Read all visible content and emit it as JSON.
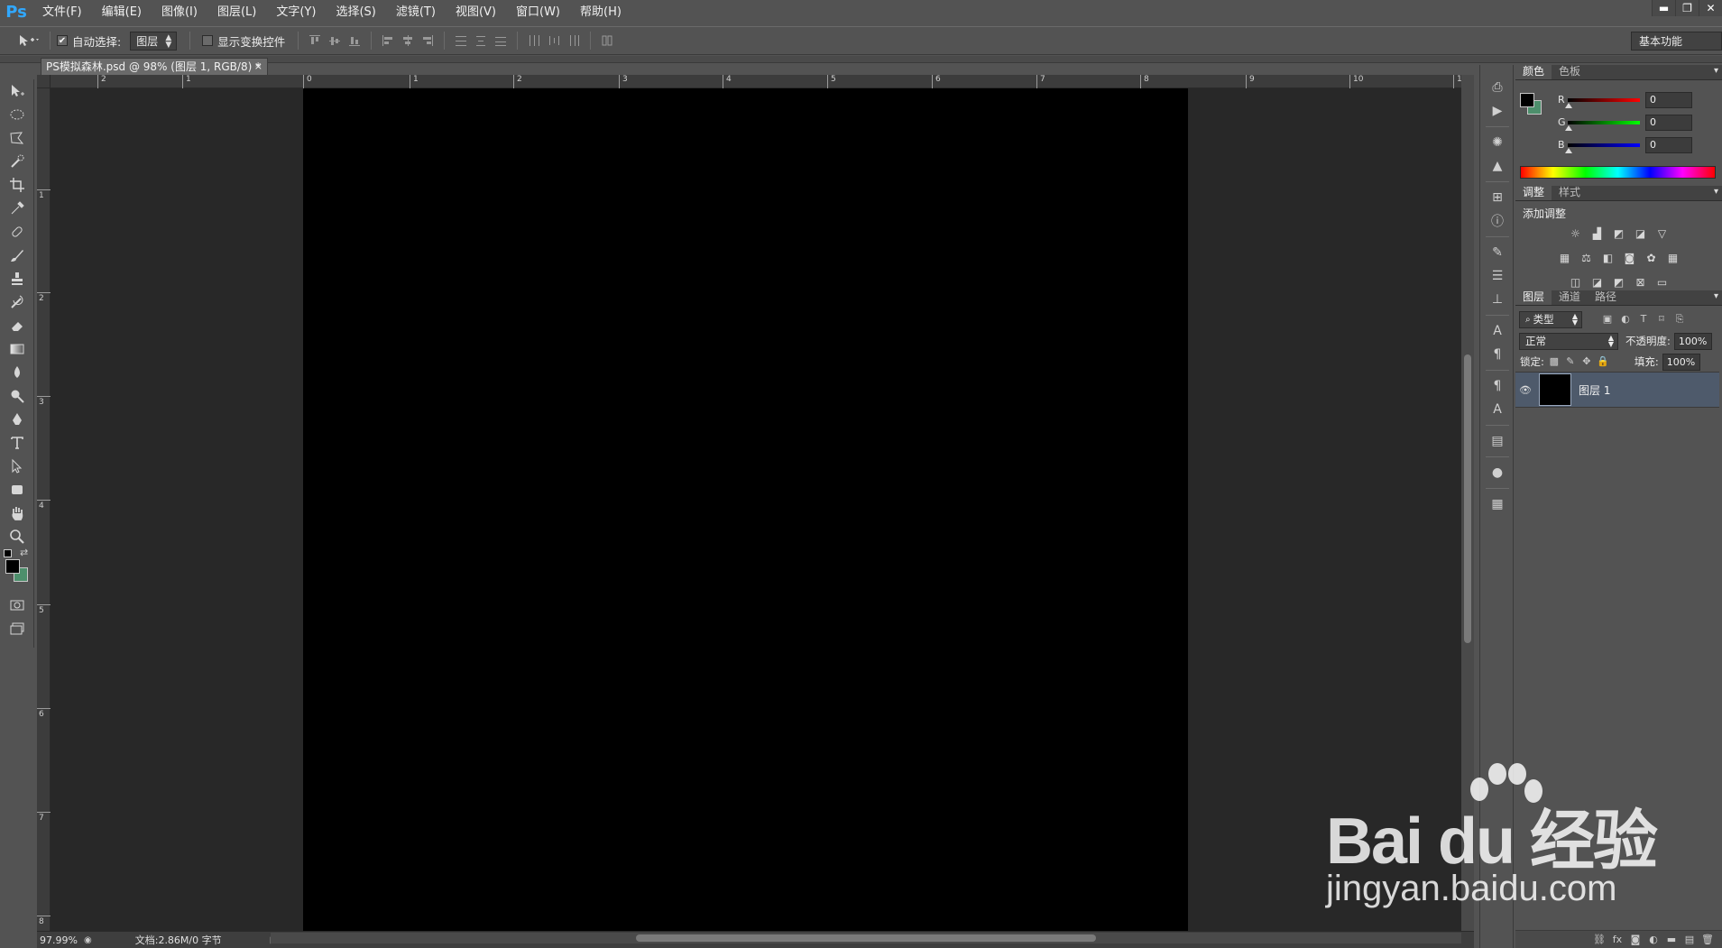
{
  "app": {
    "logo": "Ps"
  },
  "menu": [
    "文件(F)",
    "编辑(E)",
    "图像(I)",
    "图层(L)",
    "文字(Y)",
    "选择(S)",
    "滤镜(T)",
    "视图(V)",
    "窗口(W)",
    "帮助(H)"
  ],
  "window_controls": {
    "minimize": "▬",
    "restore": "❐",
    "close": "✕"
  },
  "options": {
    "auto_select_label": "自动选择:",
    "auto_select_value": "图层",
    "show_transform_label": "显示变换控件",
    "workspace": "基本功能"
  },
  "document": {
    "tab_title": "PS模拟森林.psd @ 98% (图层 1, RGB/8) *",
    "tab_close": "×",
    "zoom": "97.99%",
    "doc_size": "文档:2.86M/0 字节",
    "status_arrow": "▶"
  },
  "rulers": {
    "horizontal_labels": [
      "2",
      "1",
      "0",
      "1",
      "2",
      "3",
      "4",
      "5",
      "6",
      "7",
      "8",
      "9",
      "10",
      "1"
    ],
    "vertical_labels": [
      "1",
      "2",
      "3",
      "4",
      "5",
      "6",
      "7",
      "8"
    ]
  },
  "color_panel": {
    "tabs": [
      "颜色",
      "色板"
    ],
    "channels": [
      {
        "label": "R",
        "value": "0",
        "color": "#ff0000"
      },
      {
        "label": "G",
        "value": "0",
        "color": "#00ff00"
      },
      {
        "label": "B",
        "value": "0",
        "color": "#0000ff"
      }
    ],
    "foreground": "#000000",
    "background": "#4d8f6c"
  },
  "adjustments_panel": {
    "tabs": [
      "调整",
      "样式"
    ],
    "title": "添加调整"
  },
  "layers_panel": {
    "tabs": [
      "图层",
      "通道",
      "路径"
    ],
    "filter_kind": "类型",
    "blend_mode": "正常",
    "opacity_label": "不透明度:",
    "opacity_value": "100%",
    "lock_label": "锁定:",
    "fill_label": "填充:",
    "fill_value": "100%",
    "layers": [
      {
        "name": "图层 1",
        "visible": true,
        "selected": true
      }
    ]
  },
  "watermark": {
    "brand": "Bai du 经验",
    "url": "jingyan.baidu.com"
  }
}
